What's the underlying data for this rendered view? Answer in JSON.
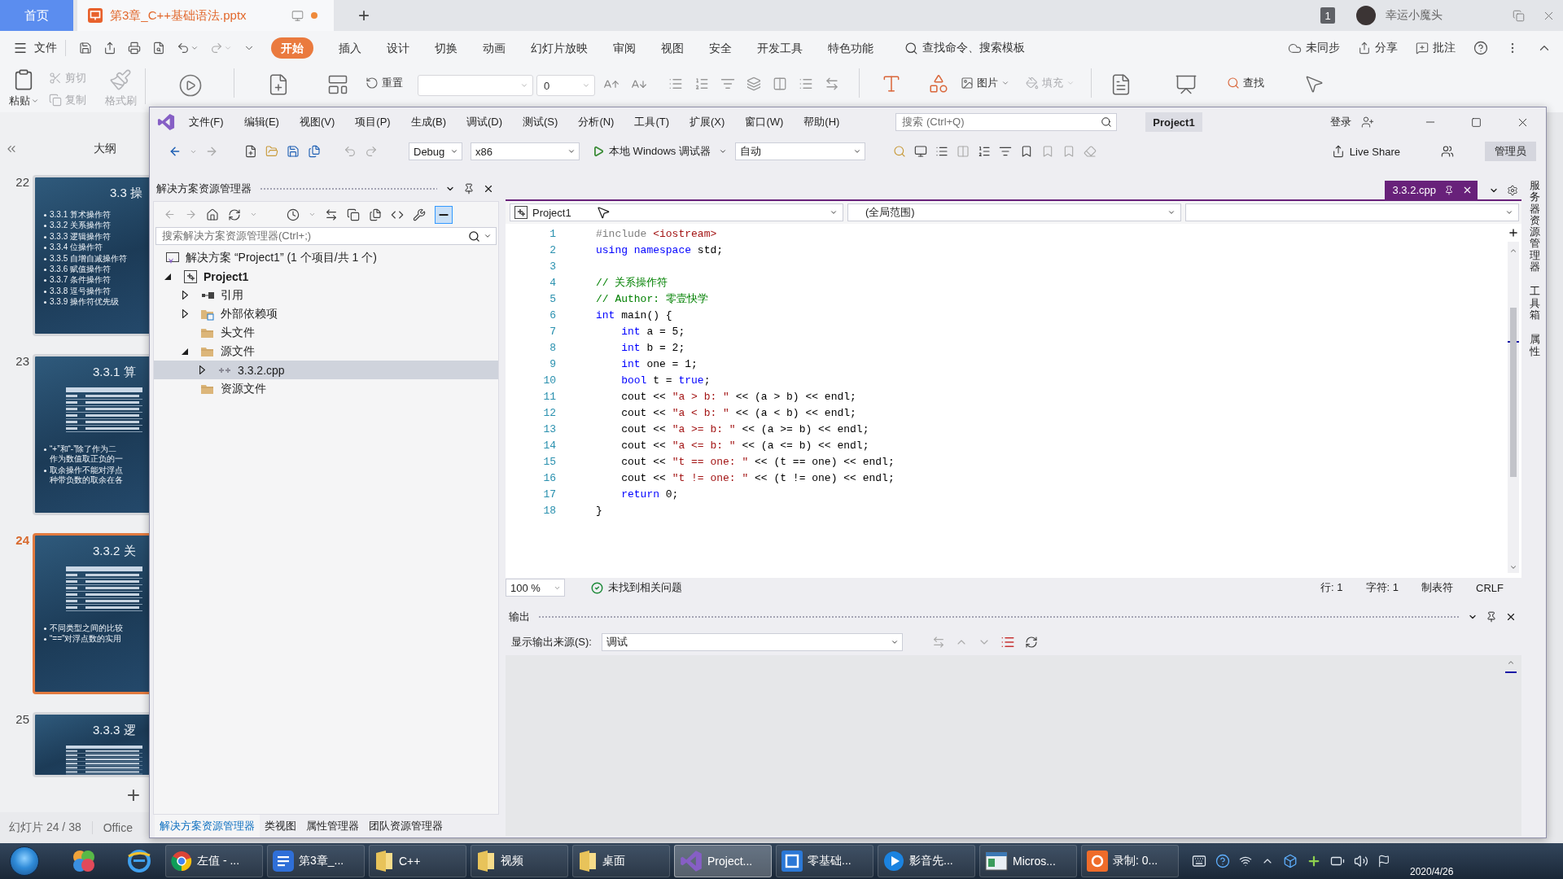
{
  "wps": {
    "tabs": [
      {
        "label": "首页",
        "kind": "home",
        "selected": false
      },
      {
        "label": "第3章_C++基础语法.pptx",
        "kind": "doc",
        "selected": true,
        "unsaved": true
      }
    ],
    "new_tab": "+",
    "account": {
      "badge": "1",
      "name": "幸运小魔头"
    },
    "file_menu": "文件",
    "menu": [
      {
        "label": "开始",
        "selected": true
      },
      {
        "label": "插入",
        "selected": false
      },
      {
        "label": "设计",
        "selected": false
      },
      {
        "label": "切换",
        "selected": false
      },
      {
        "label": "动画",
        "selected": false
      },
      {
        "label": "幻灯片放映",
        "selected": false
      },
      {
        "label": "审阅",
        "selected": false
      },
      {
        "label": "视图",
        "selected": false
      },
      {
        "label": "安全",
        "selected": false
      },
      {
        "label": "开发工具",
        "selected": false
      },
      {
        "label": "特色功能",
        "selected": false
      }
    ],
    "command_search": "查找命令、搜索模板",
    "sync": "未同步",
    "share": "分享",
    "comment": "批注",
    "ribbon": {
      "paste": "粘贴",
      "cut": {
        "label": "剪切",
        "disabled": true
      },
      "copy": {
        "label": "复制",
        "disabled": true
      },
      "format_painter": {
        "label": "格式刷",
        "disabled": true
      },
      "reset": "重置",
      "font_size": "0",
      "picture": "图片",
      "fill": {
        "label": "填充",
        "disabled": true
      },
      "find": "查找"
    },
    "outline_tab": "大纲",
    "slides": [
      {
        "number": "22",
        "selected": false,
        "kind": "list",
        "title": "3.3 操",
        "bullets": [
          {
            "lines": [
              "3.3.1 算术操作符"
            ]
          },
          {
            "lines": [
              "3.3.2 关系操作符"
            ]
          },
          {
            "lines": [
              "3.3.3 逻辑操作符"
            ]
          },
          {
            "lines": [
              "3.3.4 位操作符"
            ]
          },
          {
            "lines": [
              "3.3.5 自增自减操作符"
            ]
          },
          {
            "lines": [
              "3.3.6 赋值操作符"
            ]
          },
          {
            "lines": [
              "3.3.7 条件操作符"
            ]
          },
          {
            "lines": [
              "3.3.8 逗号操作符"
            ]
          },
          {
            "lines": [
              "3.3.9 操作符优先级"
            ]
          }
        ]
      },
      {
        "number": "23",
        "selected": false,
        "kind": "table",
        "title": "3.3.1 算",
        "bullets": [
          {
            "lines": [
              "“+”和“-”除了作为二",
              "作为数值取正负的一"
            ]
          },
          {
            "lines": [
              "取余操作不能对浮点",
              "种带负数的取余在各"
            ]
          }
        ]
      },
      {
        "number": "24",
        "selected": true,
        "kind": "table",
        "title": "3.3.2 关",
        "bullets": [
          {
            "lines": [
              "不同类型之间的比较"
            ]
          },
          {
            "lines": [
              "“==”对浮点数的实用"
            ]
          }
        ]
      },
      {
        "number": "25",
        "selected": false,
        "kind": "table",
        "title": "3.3.3 逻"
      }
    ],
    "add_slide": "+",
    "status": {
      "slide": "幻灯片 24 / 38",
      "theme": "Office"
    }
  },
  "vs": {
    "menu": [
      "文件(F)",
      "编辑(E)",
      "视图(V)",
      "项目(P)",
      "生成(B)",
      "调试(D)",
      "测试(S)",
      "分析(N)",
      "工具(T)",
      "扩展(X)",
      "窗口(W)",
      "帮助(H)"
    ],
    "search": {
      "placeholder": "搜索 (Ctrl+Q)"
    },
    "solution_name": "Project1",
    "sign_in": "登录",
    "toolbar": {
      "configuration": "Debug",
      "platform": "x86",
      "run": "本地 Windows 调试器",
      "run_mode": "自动",
      "live_share": "Live Share",
      "admin": "管理员"
    },
    "solution_explorer": {
      "title": "解决方案资源管理器",
      "search": {
        "placeholder": "搜索解决方案资源管理器(Ctrl+;)"
      },
      "tree": [
        {
          "label": "解决方案 “Project1” (1 个项目/共 1 个)",
          "kind": "solution",
          "selected": false,
          "children": [
            {
              "label": "Project1",
              "kind": "project",
              "expanded": true,
              "selected": false,
              "children": [
                {
                  "label": "引用",
                  "kind": "references",
                  "expanded": false,
                  "selected": false
                },
                {
                  "label": "外部依赖项",
                  "kind": "dependencies",
                  "expanded": false,
                  "selected": false
                },
                {
                  "label": "头文件",
                  "kind": "folder",
                  "selected": false
                },
                {
                  "label": "源文件",
                  "kind": "folder",
                  "expanded": true,
                  "selected": false,
                  "children": [
                    {
                      "label": "3.3.2.cpp",
                      "kind": "cpp",
                      "expanded": false,
                      "selected": true
                    }
                  ]
                },
                {
                  "label": "资源文件",
                  "kind": "folder",
                  "selected": false
                }
              ]
            }
          ]
        }
      ],
      "tabs": [
        {
          "label": "解决方案资源管理器",
          "selected": true
        },
        {
          "label": "类视图",
          "selected": false
        },
        {
          "label": "属性管理器",
          "selected": false
        },
        {
          "label": "团队资源管理器",
          "selected": false
        }
      ]
    },
    "editor": {
      "tab": {
        "label": "3.3.2.cpp",
        "selected": true
      },
      "nav": {
        "project": "Project1",
        "scope": "(全局范围)"
      },
      "lines": [
        {
          "number": "1",
          "tokens": [
            {
              "kind": "preprocessor",
              "text": "#include "
            },
            {
              "kind": "string",
              "text": "<iostream>"
            }
          ]
        },
        {
          "number": "2",
          "tokens": [
            {
              "kind": "keyword",
              "text": "using"
            },
            {
              "kind": "keyword",
              "text": " namespace"
            },
            {
              "kind": "plain",
              "text": " std;"
            }
          ]
        },
        {
          "number": "3"
        },
        {
          "number": "4",
          "tokens": [
            {
              "kind": "comment",
              "text": "// 关系操作符"
            }
          ]
        },
        {
          "number": "5",
          "tokens": [
            {
              "kind": "comment",
              "text": "// Author: 零壹快学"
            }
          ]
        },
        {
          "number": "6",
          "tokens": [
            {
              "kind": "keyword",
              "text": "int"
            },
            {
              "kind": "plain",
              "text": " main() {"
            }
          ]
        },
        {
          "number": "7",
          "tokens": [
            {
              "kind": "keyword",
              "text": "    int"
            },
            {
              "kind": "plain",
              "text": " a = 5;"
            }
          ]
        },
        {
          "number": "8",
          "tokens": [
            {
              "kind": "keyword",
              "text": "    int"
            },
            {
              "kind": "plain",
              "text": " b = 2;"
            }
          ]
        },
        {
          "number": "9",
          "tokens": [
            {
              "kind": "keyword",
              "text": "    int"
            },
            {
              "kind": "plain",
              "text": " one = 1;"
            }
          ]
        },
        {
          "number": "10",
          "tokens": [
            {
              "kind": "keyword",
              "text": "    bool"
            },
            {
              "kind": "plain",
              "text": " t = "
            },
            {
              "kind": "keyword",
              "text": "true"
            },
            {
              "kind": "plain",
              "text": ";"
            }
          ]
        },
        {
          "number": "11",
          "tokens": [
            {
              "kind": "plain",
              "text": "    cout << "
            },
            {
              "kind": "string",
              "text": "\"a > b: \""
            },
            {
              "kind": "plain",
              "text": " << (a > b) << endl;"
            }
          ]
        },
        {
          "number": "12",
          "tokens": [
            {
              "kind": "plain",
              "text": "    cout << "
            },
            {
              "kind": "string",
              "text": "\"a < b: \""
            },
            {
              "kind": "plain",
              "text": " << (a < b) << endl;"
            }
          ]
        },
        {
          "number": "13",
          "tokens": [
            {
              "kind": "plain",
              "text": "    cout << "
            },
            {
              "kind": "string",
              "text": "\"a >= b: \""
            },
            {
              "kind": "plain",
              "text": " << (a >= b) << endl;"
            }
          ]
        },
        {
          "number": "14",
          "tokens": [
            {
              "kind": "plain",
              "text": "    cout << "
            },
            {
              "kind": "string",
              "text": "\"a <= b: \""
            },
            {
              "kind": "plain",
              "text": " << (a <= b) << endl;"
            }
          ]
        },
        {
          "number": "15",
          "tokens": [
            {
              "kind": "plain",
              "text": "    cout << "
            },
            {
              "kind": "string",
              "text": "\"t == one: \""
            },
            {
              "kind": "plain",
              "text": " << (t == one) << endl;"
            }
          ]
        },
        {
          "number": "16",
          "tokens": [
            {
              "kind": "plain",
              "text": "    cout << "
            },
            {
              "kind": "string",
              "text": "\"t != one: \""
            },
            {
              "kind": "plain",
              "text": " << (t != one) << endl;"
            }
          ]
        },
        {
          "number": "17",
          "tokens": [
            {
              "kind": "keyword",
              "text": "    return"
            },
            {
              "kind": "plain",
              "text": " 0;"
            }
          ]
        },
        {
          "number": "18",
          "tokens": [
            {
              "kind": "plain",
              "text": "}"
            }
          ]
        }
      ],
      "zoom": "100 %",
      "issues": "未找到相关问题",
      "line": "行: 1",
      "column": "字符: 1",
      "indent": "制表符",
      "line_ending": "CRLF"
    },
    "output": {
      "title": "输出",
      "source_label": "显示输出来源(S):",
      "source": "调试"
    },
    "side_tabs": [
      "服务器资源管理器",
      "工具箱",
      "属性"
    ]
  },
  "taskbar": {
    "items": [
      {
        "label": "左值 - ...",
        "kind": "browser",
        "selected": false
      },
      {
        "label": "第3章_...",
        "kind": "writer",
        "selected": false
      },
      {
        "label": "C++",
        "kind": "folder",
        "selected": false
      },
      {
        "label": "视频",
        "kind": "folder",
        "selected": false
      },
      {
        "label": "桌面",
        "kind": "folder",
        "selected": false
      },
      {
        "label": "Project...",
        "kind": "ide",
        "selected": true
      },
      {
        "label": "零基础...",
        "kind": "work",
        "selected": false
      },
      {
        "label": "影音先...",
        "kind": "player",
        "selected": false
      },
      {
        "label": "Micros...",
        "kind": "app",
        "selected": false
      },
      {
        "label": "录制: 0...",
        "kind": "recorder",
        "selected": false
      }
    ],
    "date": "2020/4/26"
  }
}
